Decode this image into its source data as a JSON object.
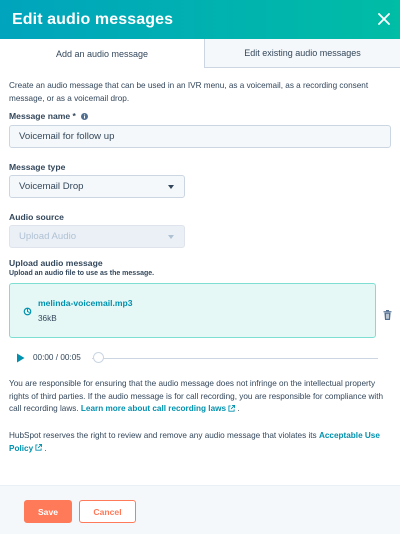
{
  "header": {
    "title": "Edit audio messages"
  },
  "tabs": [
    {
      "label": "Add an audio message",
      "active": true
    },
    {
      "label": "Edit existing audio messages",
      "active": false
    }
  ],
  "intro": "Create an audio message that can be used in an IVR menu, as a voicemail, as a recording consent message, or as a voicemail drop.",
  "form": {
    "message_name_label": "Message name *",
    "message_name_value": "Voicemail for follow up",
    "message_type_label": "Message type",
    "message_type_value": "Voicemail Drop",
    "audio_source_label": "Audio source",
    "audio_source_value": "Upload Audio",
    "upload_label": "Upload audio message",
    "upload_sublabel": "Upload an audio file to use as the message."
  },
  "file": {
    "name": "melinda-voicemail.mp3",
    "size": "36kB"
  },
  "player": {
    "time": "00:00 / 00:05",
    "progress": 0
  },
  "compliance": {
    "text": "You are responsible for ensuring that the audio message does not infringe on the intellectual property rights of third parties. If the audio message is for call recording, you are responsible for compliance with call recording laws.",
    "link": "Learn more about call recording laws",
    "suffix": "."
  },
  "policy": {
    "text": "HubSpot reserves the right to review and remove any audio message that violates its",
    "link": "Acceptable Use Policy",
    "suffix": "."
  },
  "footer": {
    "save_label": "Save",
    "cancel_label": "Cancel"
  },
  "colors": {
    "accent": "#00bda5",
    "link": "#0091ae",
    "primary_button": "#ff7a59",
    "text": "#33475b"
  }
}
